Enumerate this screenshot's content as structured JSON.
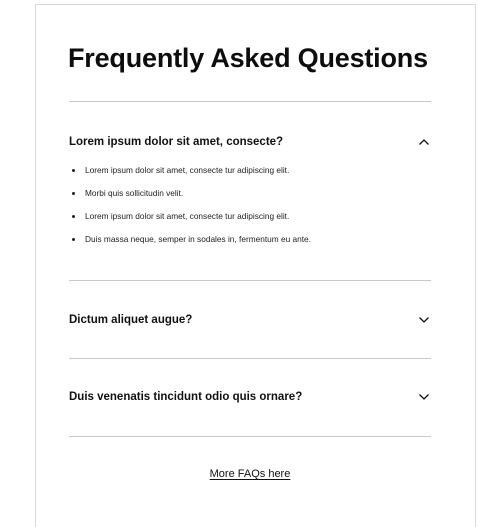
{
  "title": "Frequently Asked Questions",
  "faqs": [
    {
      "question": "Lorem ipsum dolor sit amet, consecte?",
      "expanded": true,
      "icon": "chevron-up-icon",
      "answers": [
        "Lorem ipsum dolor sit amet, consecte tur adipiscing elit.",
        "Morbi quis sollicitudin velit.",
        "Lorem ipsum dolor sit amet, consecte tur adipiscing elit.",
        "Duis massa neque, semper in sodales in, fermentum eu ante."
      ]
    },
    {
      "question": "Dictum aliquet augue?",
      "expanded": false,
      "icon": "chevron-down-icon"
    },
    {
      "question": "Duis venenatis tincidunt odio quis ornare?",
      "expanded": false,
      "icon": "chevron-down-icon"
    }
  ],
  "more_link": "More FAQs here",
  "colors": {
    "text": "#111111",
    "divider": "#c8c8c8",
    "background": "#ffffff"
  }
}
